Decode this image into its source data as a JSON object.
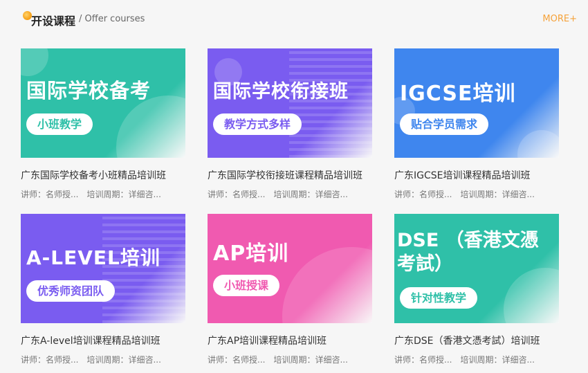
{
  "header": {
    "title": "开设课程",
    "subtitle": "/ Offer courses",
    "more": "MORE+",
    "accent": "#f5a23a"
  },
  "courses": [
    {
      "banner_title": "国际学校备考",
      "banner_tag": "小班教学",
      "title": "广东国际学校备考小班精品培训班",
      "teacher": "讲师：名师授...",
      "period": "培训周期：详细咨...",
      "color": "#2fc0a8"
    },
    {
      "banner_title": "国际学校衔接班",
      "banner_tag": "教学方式多样",
      "title": "广东国际学校衔接班课程精品培训班",
      "teacher": "讲师：名师授...",
      "period": "培训周期：详细咨...",
      "color": "#7a5cf0"
    },
    {
      "banner_title": "IGCSE培训",
      "banner_tag": "贴合学员需求",
      "title": "广东IGCSE培训课程精品培训班",
      "teacher": "讲师：名师授...",
      "period": "培训周期：详细咨...",
      "color": "#3f86ee"
    },
    {
      "banner_title": "A-LEVEL培训",
      "banner_tag": "优秀师资团队",
      "title": "广东A-level培训课程精品培训班",
      "teacher": "讲师：名师授...",
      "period": "培训周期：详细咨...",
      "color": "#7a5cf0"
    },
    {
      "banner_title": "AP培训",
      "banner_tag": "小班授课",
      "title": "广东AP培训课程精品培训班",
      "teacher": "讲师：名师授...",
      "period": "培训周期：详细咨...",
      "color": "#f05ab0"
    },
    {
      "banner_title": "DSE （香港文憑考試）",
      "banner_tag": "针对性教学",
      "title": "广东DSE（香港文憑考試）培训班",
      "teacher": "讲师：名师授...",
      "period": "培训周期：详细咨...",
      "color": "#2fc0a8"
    }
  ]
}
